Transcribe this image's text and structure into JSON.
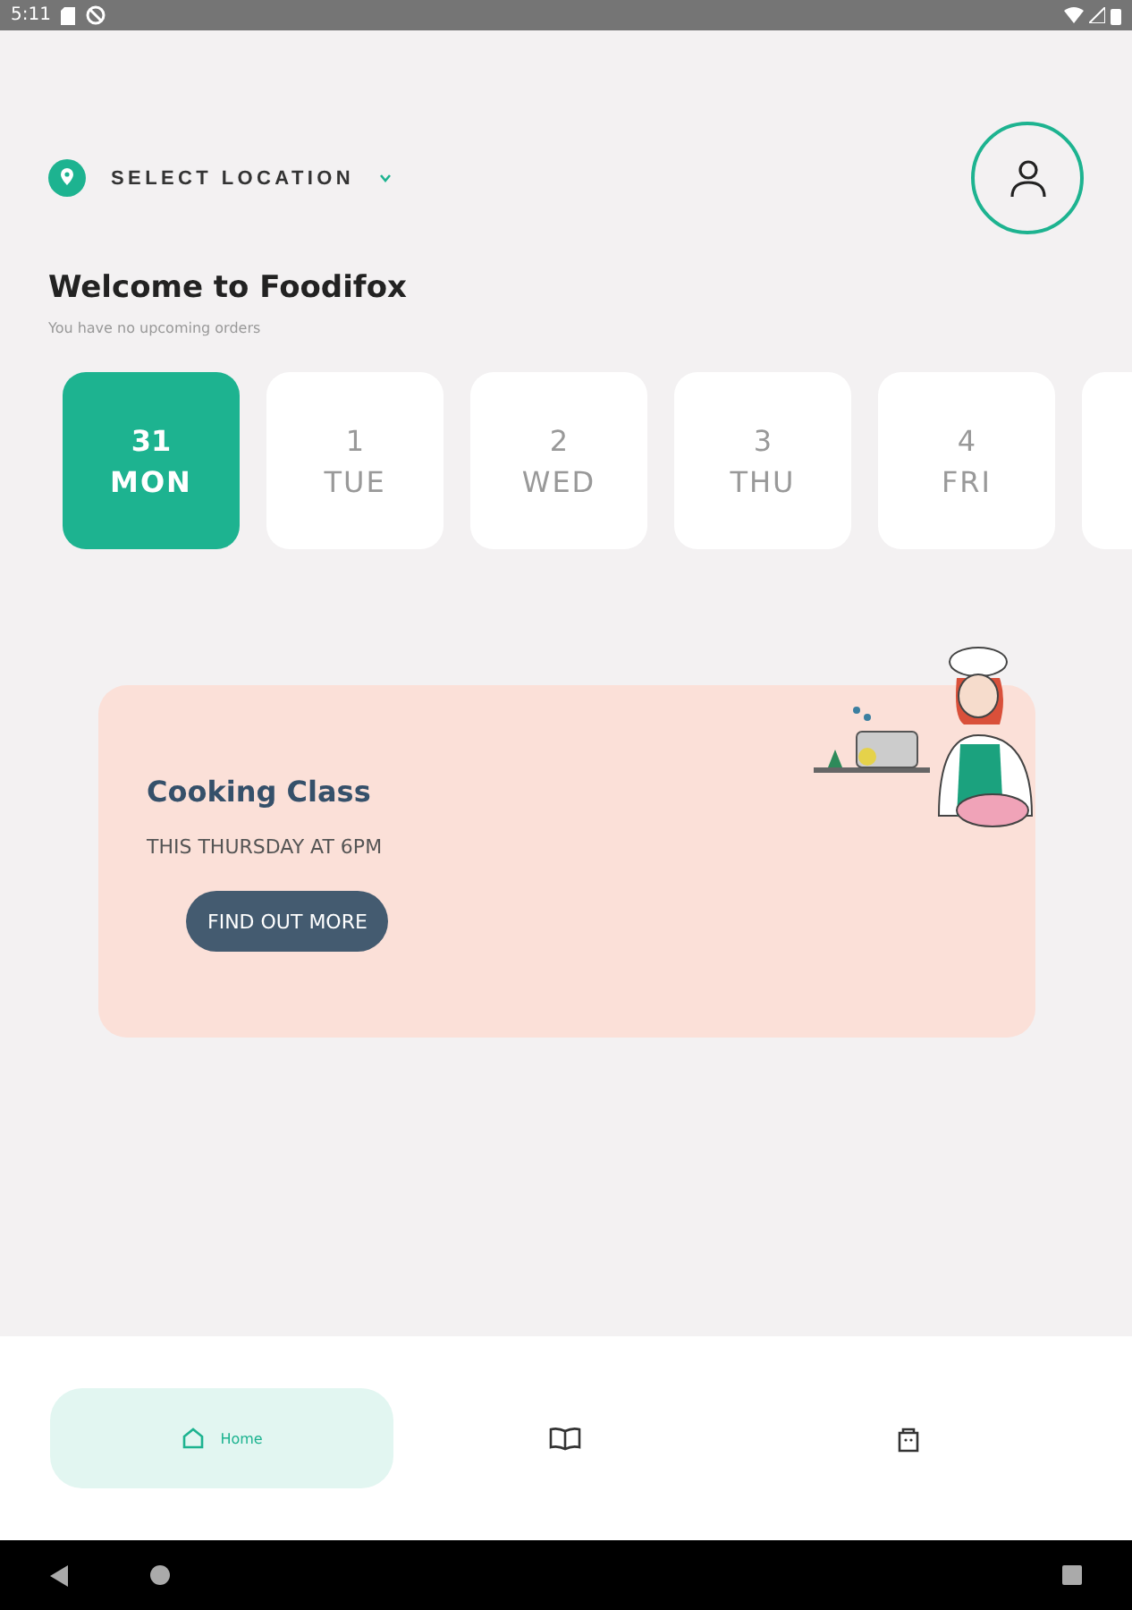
{
  "status_bar": {
    "time": "5:11"
  },
  "location": {
    "label": "SELECT LOCATION"
  },
  "welcome": {
    "title": "Welcome to Foodifox",
    "subtitle": "You have no upcoming orders"
  },
  "dates": [
    {
      "day": "31",
      "weekday": "MON",
      "selected": true
    },
    {
      "day": "1",
      "weekday": "TUE",
      "selected": false
    },
    {
      "day": "2",
      "weekday": "WED",
      "selected": false
    },
    {
      "day": "3",
      "weekday": "THU",
      "selected": false
    },
    {
      "day": "4",
      "weekday": "FRI",
      "selected": false
    }
  ],
  "banner": {
    "title": "Cooking Class",
    "subtitle": "THIS THURSDAY AT 6PM",
    "button": "FIND OUT MORE"
  },
  "nav": [
    {
      "kind": "home",
      "label": "Home",
      "selected": true
    },
    {
      "kind": "book",
      "selected": false
    },
    {
      "kind": "bag",
      "selected": false
    }
  ]
}
